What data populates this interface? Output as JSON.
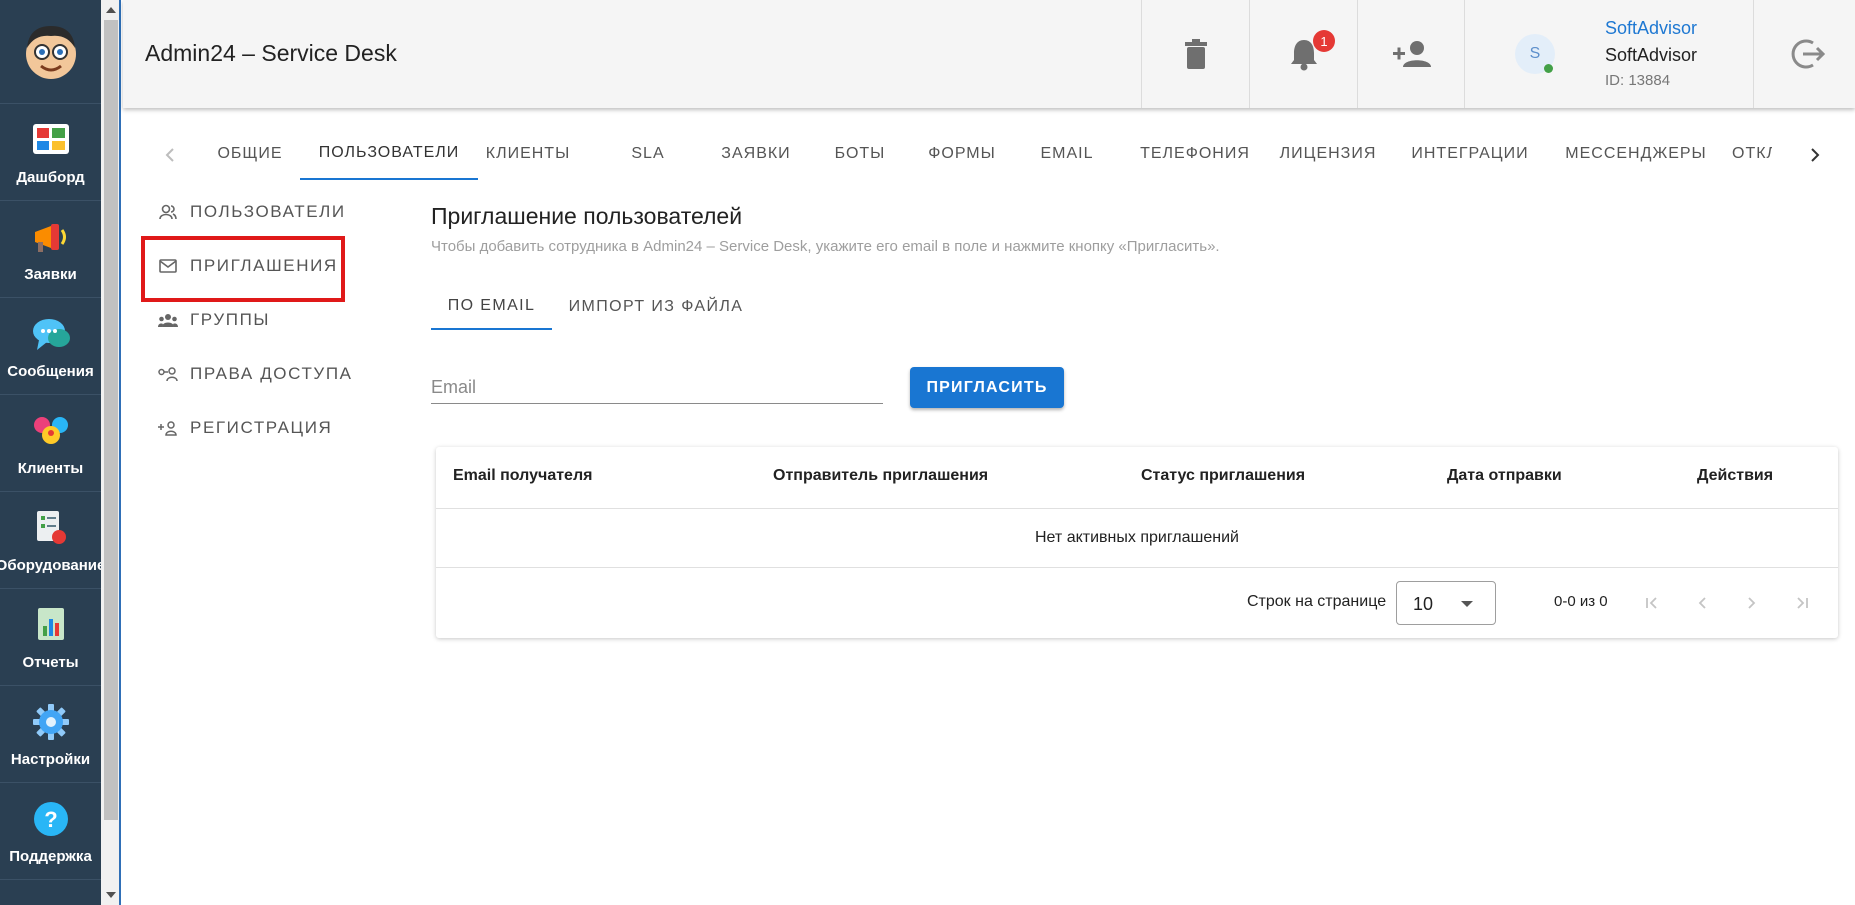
{
  "sidebar": {
    "logo_icon": "avatar-face-logo",
    "items": [
      {
        "label": "Дашборд",
        "icon": "dashboard-icon"
      },
      {
        "label": "Заявки",
        "icon": "megaphone-icon"
      },
      {
        "label": "Сообщения",
        "icon": "chat-icon"
      },
      {
        "label": "Клиенты",
        "icon": "clients-icon"
      },
      {
        "label": "Оборудование",
        "icon": "equipment-icon"
      },
      {
        "label": "Отчеты",
        "icon": "reports-icon"
      },
      {
        "label": "Настройки",
        "icon": "gear-icon"
      },
      {
        "label": "Поддержка",
        "icon": "help-icon"
      }
    ]
  },
  "header": {
    "title": "Admin24 – Service Desk",
    "notifications_count": "1",
    "user": {
      "avatar_letter": "S",
      "link": "SoftAdvisor",
      "name": "SoftAdvisor",
      "id": "ID: 13884"
    }
  },
  "tabs": [
    {
      "label": "ОБЩИЕ"
    },
    {
      "label": "ПОЛЬЗОВАТЕЛИ",
      "active": true
    },
    {
      "label": "КЛИЕНТЫ"
    },
    {
      "label": "SLA"
    },
    {
      "label": "ЗАЯВКИ"
    },
    {
      "label": "БОТЫ"
    },
    {
      "label": "ФОРМЫ"
    },
    {
      "label": "EMAIL"
    },
    {
      "label": "ТЕЛЕФОНИЯ"
    },
    {
      "label": "ЛИЦЕНЗИЯ"
    },
    {
      "label": "ИНТЕГРАЦИИ"
    },
    {
      "label": "МЕССЕНДЖЕРЫ"
    },
    {
      "label": "ОТКЛ"
    }
  ],
  "submenu": [
    {
      "label": "ПОЛЬЗОВАТЕЛИ",
      "icon": "users-icon"
    },
    {
      "label": "ПРИГЛАШЕНИЯ",
      "icon": "mail-icon",
      "selected": true
    },
    {
      "label": "ГРУППЫ",
      "icon": "groups-icon"
    },
    {
      "label": "ПРАВА ДОСТУПА",
      "icon": "access-key-icon"
    },
    {
      "label": "РЕГИСТРАЦИЯ",
      "icon": "add-user-icon"
    }
  ],
  "main": {
    "title": "Приглашение пользователей",
    "subtitle": "Чтобы добавить сотрудника в Admin24 – Service Desk, укажите его email в поле и нажмите кнопку «Пригласить».",
    "inner_tabs": [
      {
        "label": "ПО EMAIL",
        "active": true
      },
      {
        "label": "ИМПОРТ ИЗ ФАЙЛА"
      }
    ],
    "email_placeholder": "Email",
    "invite_label": "ПРИГЛАСИТЬ"
  },
  "table": {
    "columns": [
      "Email получателя",
      "Отправитель приглашения",
      "Статус приглашения",
      "Дата отправки",
      "Действия"
    ],
    "empty_message": "Нет активных приглашений",
    "rows_per_page_label": "Строк на странице",
    "rows_per_page": "10",
    "range": "0-0 из 0"
  },
  "colors": {
    "sidebar_bg": "#2a3f52",
    "accent": "#1976d2",
    "highlight_box": "#e01919",
    "badge": "#e53935"
  }
}
